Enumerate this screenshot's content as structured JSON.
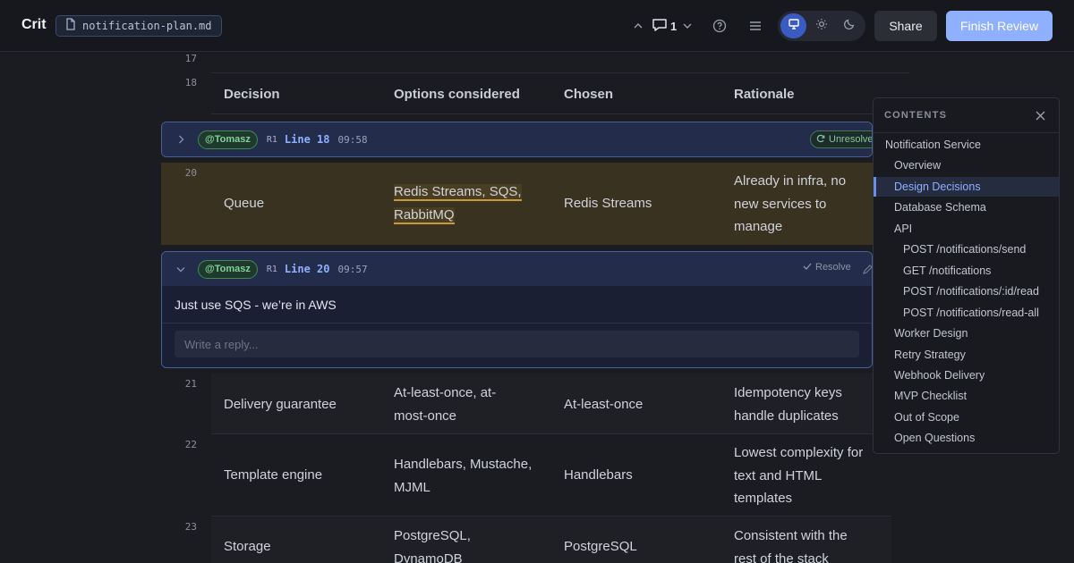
{
  "header": {
    "brand": "Crit",
    "file_name": "notification-plan.md",
    "comment_count": "1",
    "share_label": "Share",
    "finish_label": "Finish Review"
  },
  "document": {
    "line_numbers": [
      "17",
      "18",
      "20",
      "21",
      "22",
      "23"
    ],
    "columns": [
      "Decision",
      "Options considered",
      "Chosen",
      "Rationale"
    ],
    "rows": [
      {
        "line": "20",
        "decision": "Queue",
        "options": [
          "Redis Streams, SQS,",
          "RabbitMQ"
        ],
        "chosen": "Redis Streams",
        "rationale": [
          "Already in infra, no",
          "new services to",
          "manage"
        ]
      },
      {
        "line": "21",
        "decision": "Delivery guarantee",
        "options": [
          "At-least-once, at-",
          "most-once"
        ],
        "chosen": "At-least-once",
        "rationale": [
          "Idempotency keys",
          "handle duplicates"
        ]
      },
      {
        "line": "22",
        "decision": "Template engine",
        "options": [
          "Handlebars, Mustache,",
          "MJML"
        ],
        "chosen": "Handlebars",
        "rationale": [
          "Lowest complexity for",
          "text and HTML",
          "templates"
        ]
      },
      {
        "line": "23",
        "decision": "Storage",
        "options": [
          "PostgreSQL,",
          "DynamoDB"
        ],
        "chosen": "PostgreSQL",
        "rationale": [
          "Consistent with the",
          "rest of the stack"
        ]
      }
    ]
  },
  "comments": [
    {
      "author": "@Tomasz",
      "revision": "R1",
      "line": "Line 18",
      "time": "09:58",
      "action": "Unresolve",
      "collapsed": true
    },
    {
      "author": "@Tomasz",
      "revision": "R1",
      "line": "Line 20",
      "time": "09:57",
      "action": "Resolve",
      "collapsed": false,
      "text": "Just use SQS - we’re in AWS",
      "reply_placeholder": "Write a reply..."
    }
  ],
  "toc": {
    "title": "CONTENTS",
    "items": [
      "Notification Service",
      "Overview",
      "Design Decisions",
      "Database Schema",
      "API",
      "POST /notifications/send",
      "GET /notifications",
      "POST /notifications/:id/read",
      "POST /notifications/read-all",
      "Worker Design",
      "Retry Strategy",
      "Webhook Delivery",
      "MVP Checklist",
      "Out of Scope",
      "Open Questions"
    ],
    "active": "Design Decisions"
  },
  "colors": {
    "accent": "#8fb0ff",
    "highlight_row": "#3a3220",
    "resolved_green": "#82c79a"
  },
  "icons": [
    "file-icon",
    "chevron-up-icon",
    "comment-icon",
    "chevron-down-icon",
    "help-icon",
    "menu-icon",
    "monitor-icon",
    "sun-icon",
    "moon-icon",
    "close-icon",
    "chevron-right-icon",
    "refresh-icon",
    "check-icon",
    "pencil-icon"
  ]
}
